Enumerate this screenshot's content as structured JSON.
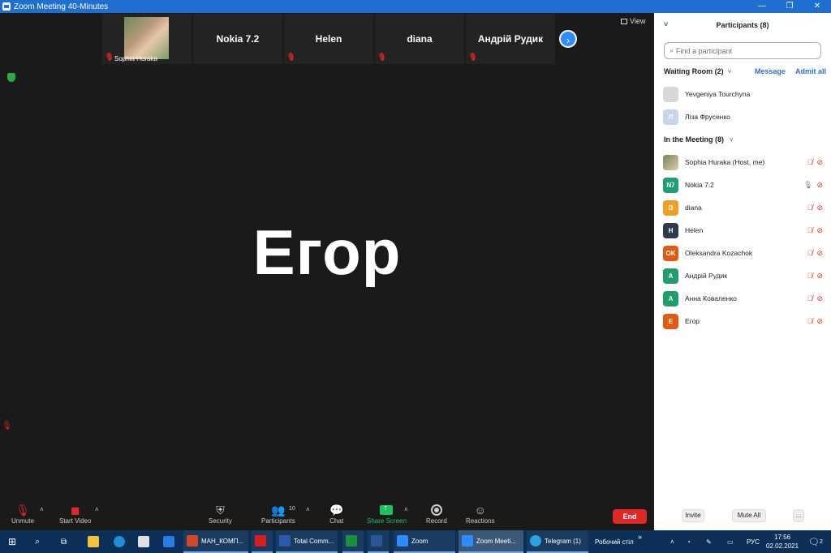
{
  "window": {
    "title": "Zoom Meeting 40-Minutes",
    "minimize": "—",
    "maximize": "❐",
    "close": "✕"
  },
  "view_label": "View",
  "thumbnails": [
    {
      "name": "Sophia Huraka",
      "has_photo": true
    },
    {
      "name": "Nokia 7.2"
    },
    {
      "name": "Helen"
    },
    {
      "name": "diana"
    },
    {
      "name": "Андрій Рудик"
    }
  ],
  "speaker": {
    "name": "Егор"
  },
  "toolbar": {
    "unmute": "Unmute",
    "start_video": "Start Video",
    "security": "Security",
    "participants": "Participants",
    "participants_count": "10",
    "chat": "Chat",
    "share_screen": "Share Screen",
    "record": "Record",
    "reactions": "Reactions",
    "end": "End"
  },
  "panel": {
    "title": "Participants (8)",
    "search_placeholder": "Find a participant",
    "waiting_room": {
      "title": "Waiting Room (2)",
      "message": "Message",
      "admit_all": "Admit all",
      "people": [
        {
          "name": "Yevgeniya Tourchyna",
          "avatar_text": "",
          "color": "#d8d8d8"
        },
        {
          "name": "Ліза Фрусенко",
          "avatar_text": "Л",
          "color": "#c8d4ea"
        }
      ]
    },
    "in_meeting": {
      "title": "In the Meeting (8)",
      "people": [
        {
          "name": "Sophia Huraka (Host, me)",
          "avatar_text": "",
          "color": "#a08060",
          "mic": "off"
        },
        {
          "name": "Nokia 7.2",
          "avatar_text": "N7",
          "color": "#1e9e78",
          "mic": "on"
        },
        {
          "name": "diana",
          "avatar_text": "D",
          "color": "#f0a020",
          "mic": "off"
        },
        {
          "name": "Helen",
          "avatar_text": "H",
          "color": "#2e3a50",
          "mic": "off"
        },
        {
          "name": "Oleksandra Kozachok",
          "avatar_text": "OK",
          "color": "#e05a10",
          "mic": "off"
        },
        {
          "name": "Андрій Рудик",
          "avatar_text": "A",
          "color": "#1e9e6a",
          "mic": "off"
        },
        {
          "name": "Анна Коваленко",
          "avatar_text": "A",
          "color": "#1e9e6a",
          "mic": "off"
        },
        {
          "name": "Егор",
          "avatar_text": "E",
          "color": "#e05a10",
          "mic": "off"
        }
      ]
    },
    "footer": {
      "invite": "Invite",
      "mute_all": "Mute All",
      "more": "..."
    }
  },
  "taskbar": {
    "apps": [
      {
        "label": "МАН_КОМП...",
        "color": "#d24726"
      },
      {
        "label": "",
        "color": "#d81e1e"
      },
      {
        "label": "Total Comm...",
        "color": "#2a5aa8"
      },
      {
        "label": "",
        "color": "#1e8e3e"
      },
      {
        "label": "",
        "color": "#2b579a"
      },
      {
        "label": "Zoom",
        "color": "#2d8cff"
      },
      {
        "label": "Zoom Meeti...",
        "color": "#2d8cff"
      },
      {
        "label": "Telegram (1)",
        "color": "#2aa3e0"
      }
    ],
    "desktop": "Робочий стіл",
    "lang": "РУС",
    "time": "17:56",
    "date": "02.02.2021",
    "notifications": "2"
  }
}
